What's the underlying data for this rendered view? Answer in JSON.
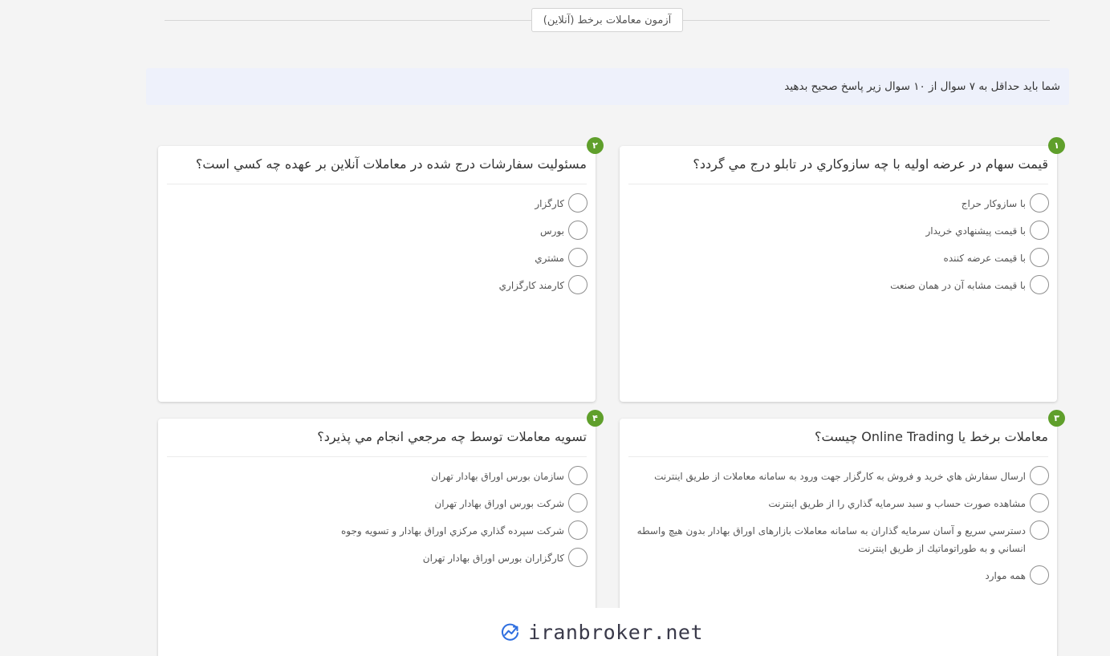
{
  "header": {
    "title": "آزمون معاملات برخط (آنلاين)"
  },
  "notice": {
    "text": "شما بايد حداقل به ۷ سوال از ۱۰ سوال زير پاسخ صحيح بدهيد"
  },
  "questions": [
    {
      "number": "۱",
      "text": "قيمت سهام در عرضه اوليه با چه سازوكاري در تابلو درج مي گردد؟",
      "options": [
        "با سازوكار حراج",
        "با قيمت پيشنهادي خريدار",
        "با قيمت عرضه كننده",
        "با قيمت مشابه آن در همان صنعت"
      ]
    },
    {
      "number": "۲",
      "text": "مسئوليت سفارشات درج شده در معاملات آنلاين بر عهده چه كسي است؟",
      "options": [
        "كارگزار",
        "بورس",
        "مشتري",
        "كارمند كارگزاري"
      ]
    },
    {
      "number": "۳",
      "text": "معاملات برخط يا Online Trading چيست؟",
      "options": [
        "ارسال سفارش هاي خريد و فروش به كارگزار جهت ورود به سامانه معاملات از طريق اينترنت",
        "مشاهده صورت حساب و سبد سرمايه گذاري را از طريق اينترنت",
        "دسترسي سريع و آسان سرمايه گذاران به سامانه معاملات بازارهای اوراق بهادار بدون هيچ واسطه انساني و به طوراتوماتيك از طريق اينترنت",
        "همه موارد"
      ]
    },
    {
      "number": "۴",
      "text": "تسويه معاملات توسط چه مرجعي انجام مي پذيرد؟",
      "options": [
        "سازمان بورس اوراق بهادار تهران",
        "شركت بورس اوراق بهادار تهران",
        "شركت سپرده گذاري مركزي اوراق بهادار و تسويه وجوه",
        "كارگزاران بورس اوراق بهادار تهران"
      ]
    }
  ],
  "watermark": {
    "text": "iranbroker.net",
    "icon": "chart-arrow-logo-icon"
  }
}
